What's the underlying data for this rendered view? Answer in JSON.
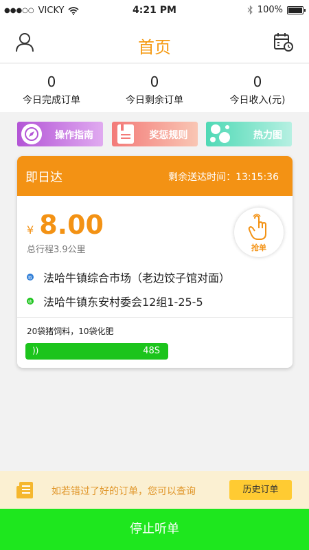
{
  "status": {
    "carrier": "VICKY",
    "time": "4:21 PM",
    "battery": "100%"
  },
  "nav": {
    "title": "首页",
    "user_icon": "user-icon",
    "calendar_icon": "calendar-clock-icon"
  },
  "stats": [
    {
      "value": "0",
      "label": "今日完成订单"
    },
    {
      "value": "0",
      "label": "今日剩余订单"
    },
    {
      "value": "0",
      "label": "今日收入(元)"
    }
  ],
  "quick_actions": [
    {
      "label": "操作指南",
      "icon": "compass-icon",
      "color": "#b355d6"
    },
    {
      "label": "奖惩规则",
      "icon": "rulebook-icon",
      "color": "#f37a78"
    },
    {
      "label": "热力图",
      "icon": "heatmap-icon",
      "color": "#4fd9b5"
    }
  ],
  "order": {
    "title": "即日达",
    "remaining_label": "剩余送达时间：",
    "remaining_time": "13:15:36",
    "currency": "¥",
    "amount": "8.00",
    "distance": "总行程3.9公里",
    "grab_label": "抢单",
    "pickup_badge": "取",
    "pickup_address": "法哈牛镇综合市场（老边饺子馆对面）",
    "dropoff_badge": "收",
    "dropoff_address": "法哈牛镇东安村委会12组1-25-5",
    "goods": "20袋猪饲料，10袋化肥",
    "countdown": "48S"
  },
  "tip": {
    "text": "如若错过了好的订单，您可以查询",
    "button": "历史订单"
  },
  "stop_button": "停止听单",
  "colors": {
    "accent": "#f39214",
    "green": "#1ee71e",
    "pickup": "#2b7bd6",
    "dropoff": "#1cc41c"
  }
}
